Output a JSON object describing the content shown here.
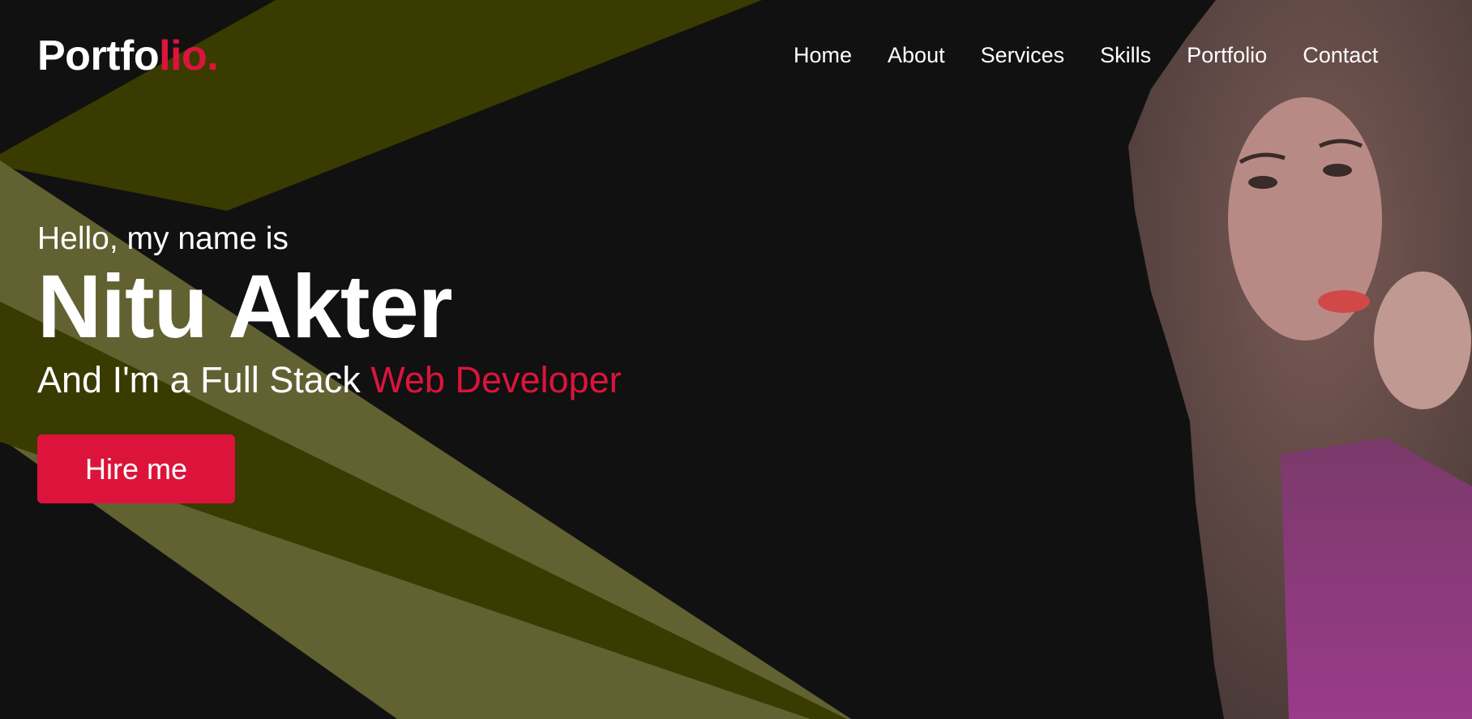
{
  "logo": {
    "main": "Portfo",
    "accent": "lio."
  },
  "nav": {
    "items": [
      "Home",
      "About",
      "Services",
      "Skills",
      "Portfolio",
      "Contact"
    ]
  },
  "hero": {
    "greeting": "Hello, my name is",
    "name": "Nitu Akter",
    "role_prefix": "And I'm a Full Stack ",
    "role_accent": "Web Developer",
    "cta_label": "Hire me"
  },
  "colors": {
    "background": "#111111",
    "accent": "#dc143c",
    "text": "#ffffff",
    "shape_dark": "#3a3b00",
    "shape_light": "#616132"
  }
}
